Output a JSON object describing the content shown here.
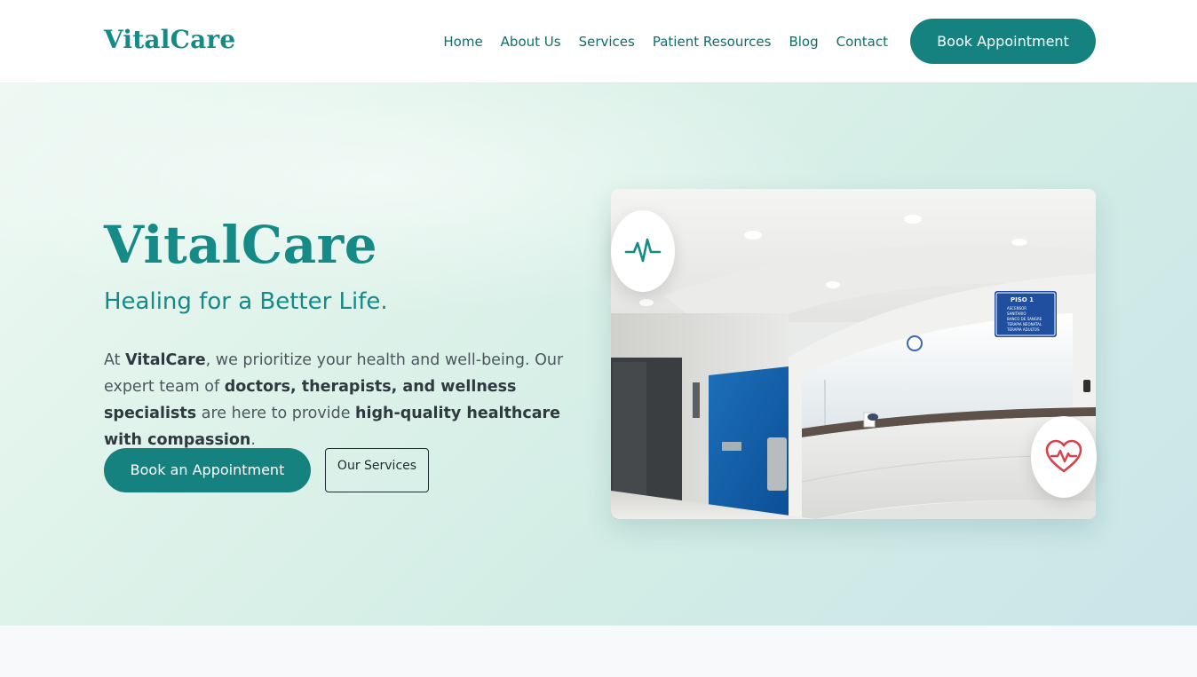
{
  "header": {
    "logo": "VitalCare",
    "nav": [
      "Home",
      "About Us",
      "Services",
      "Patient Resources",
      "Blog",
      "Contact"
    ],
    "cta": "Book Appointment"
  },
  "hero": {
    "title": "VitalCare",
    "subtitle": "Healing for a Better Life.",
    "text_parts": [
      "At ",
      "VitalCare",
      ", we prioritize your health and well-being. Our expert team of ",
      "doctors, therapists, and wellness specialists",
      " are here to provide ",
      "high-quality healthcare with compassion",
      "."
    ],
    "primary_button": "Book an Appointment",
    "secondary_button": "Our Services",
    "photo_sign": {
      "title": "PISO 1",
      "lines": [
        "ASCENSOR",
        "SANITARIO",
        "BANCO DE SANGRE",
        "TERAPIA NEONATAL",
        "TERAPIA ADULTOS"
      ]
    },
    "icons": [
      "pulse-icon",
      "heart-pulse-icon"
    ]
  },
  "colors": {
    "brand": "#168a86",
    "button": "#168280",
    "heart": "#d7424b"
  }
}
